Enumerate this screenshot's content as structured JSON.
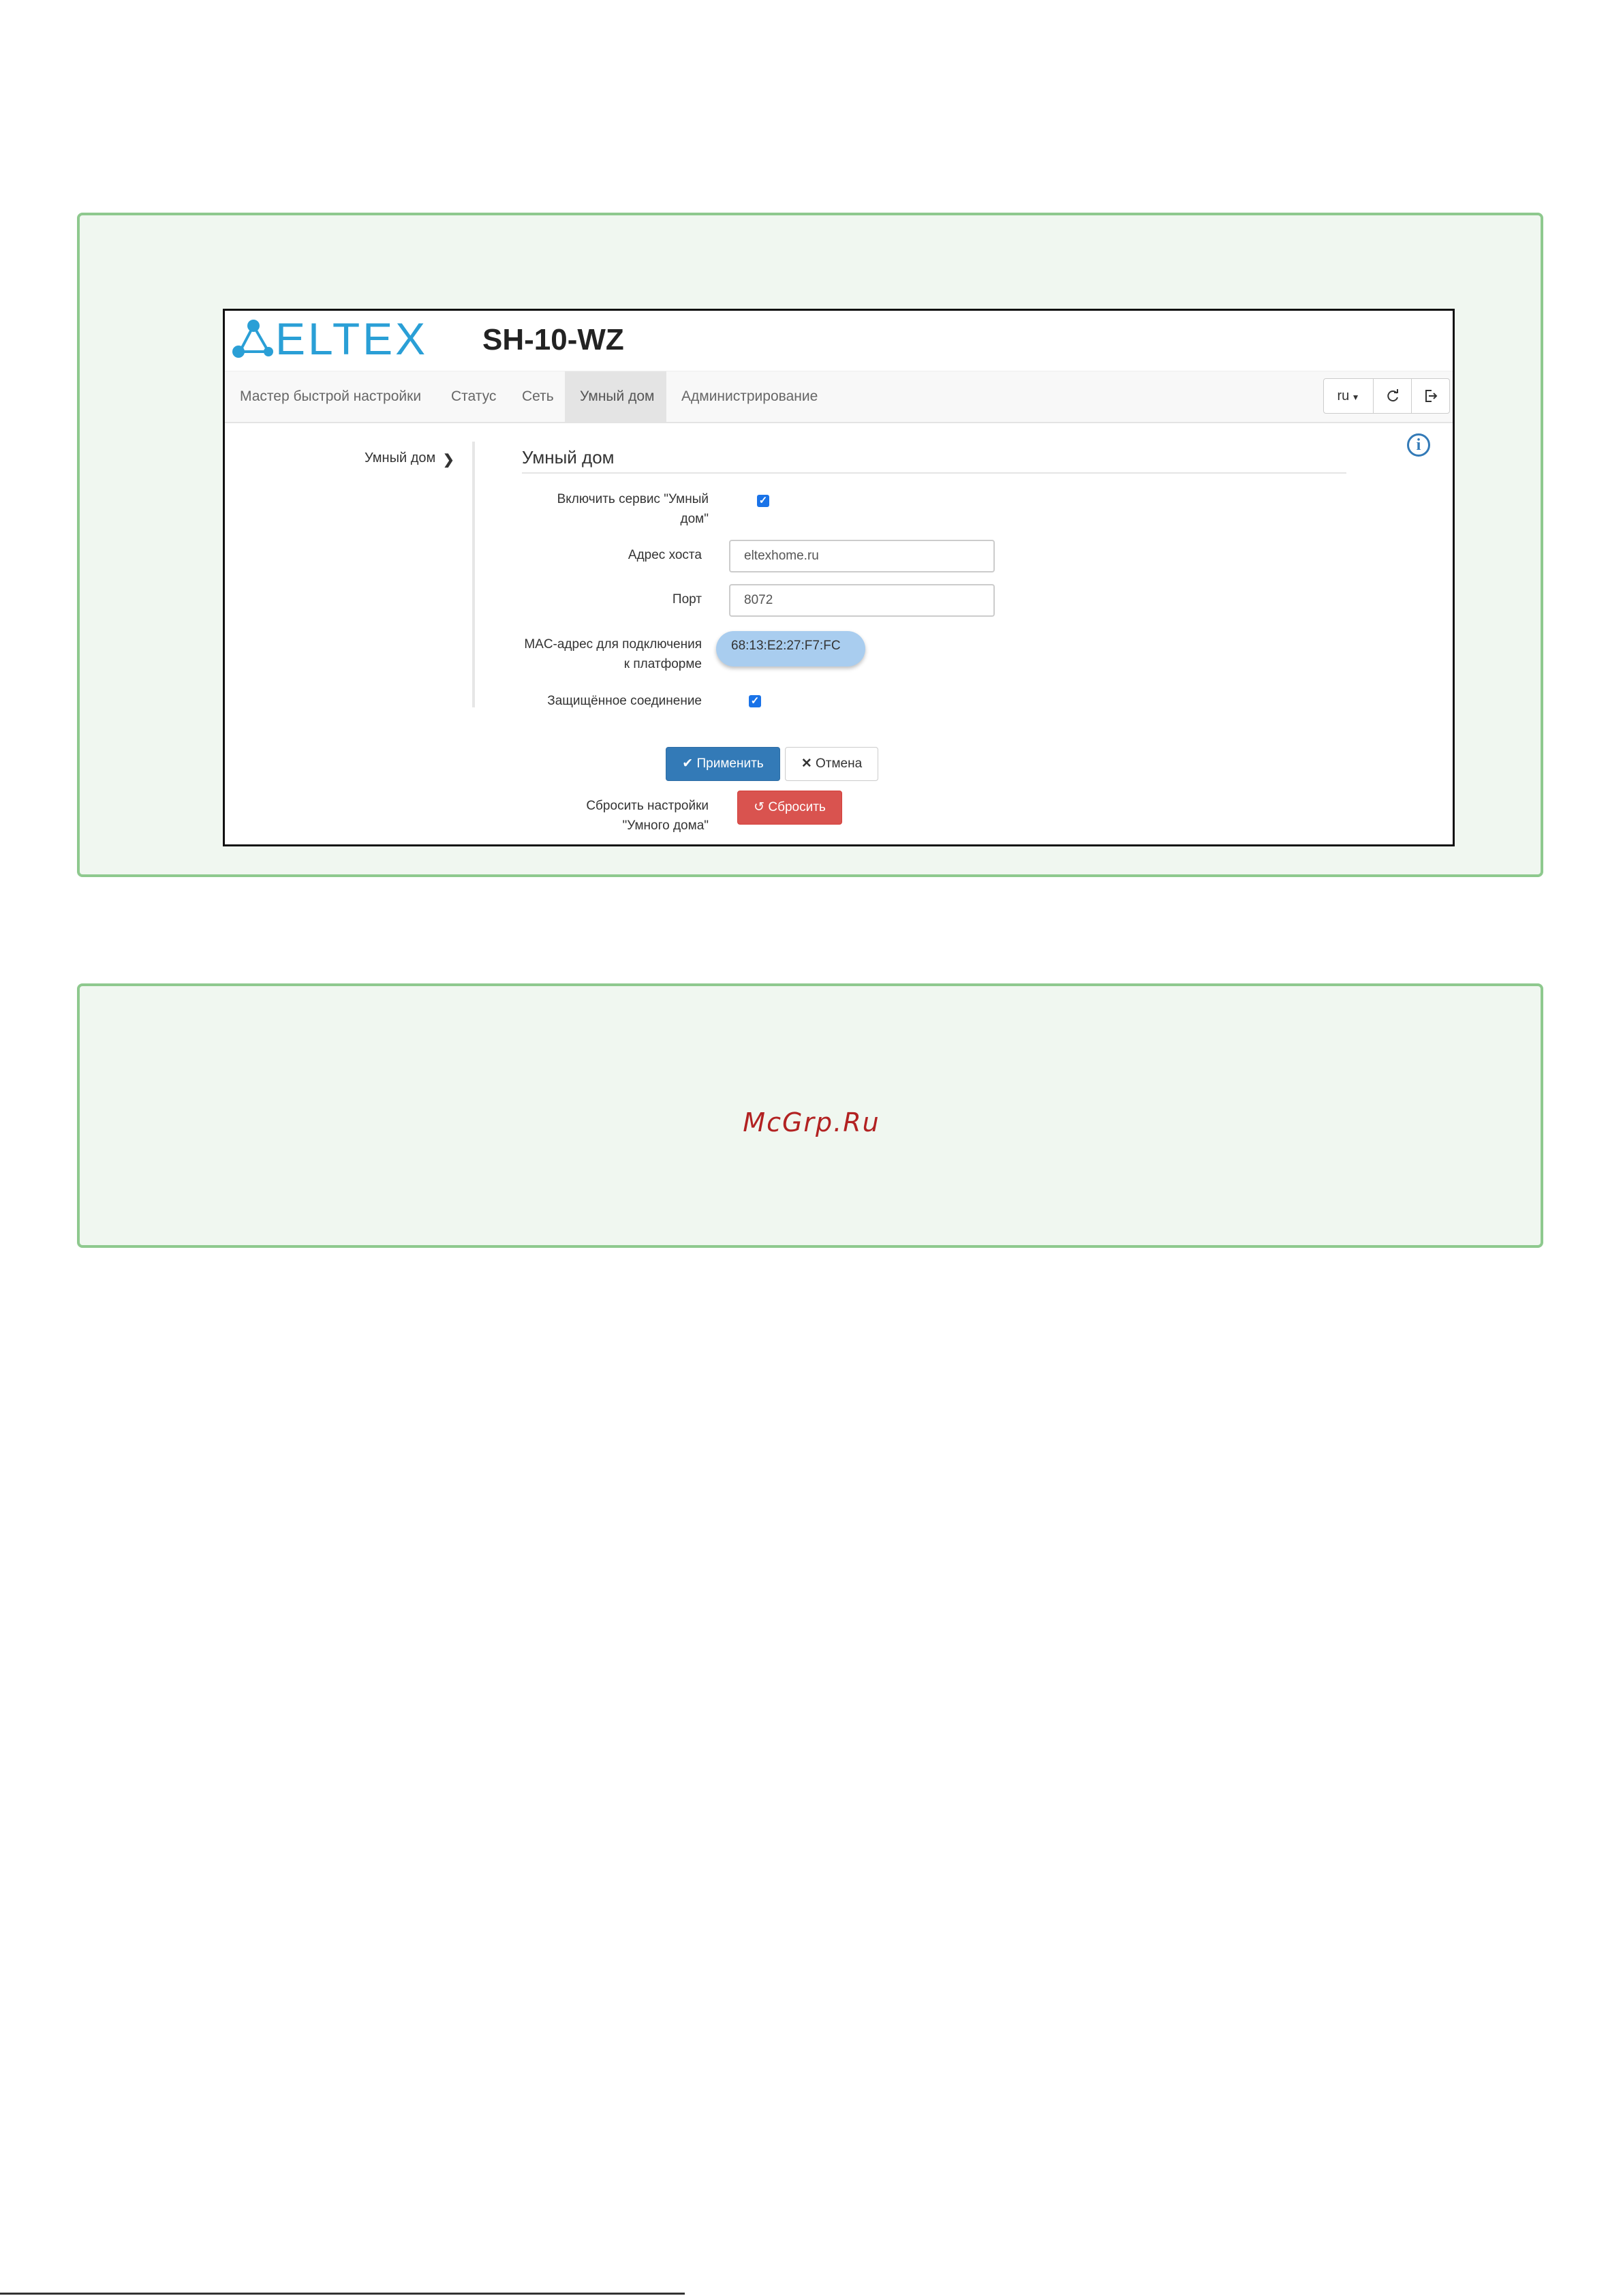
{
  "header": {
    "logo_text": "ELTEX",
    "model": "SH-10-WZ"
  },
  "nav": {
    "items": [
      {
        "label": "Мастер быстрой настройки"
      },
      {
        "label": "Статус"
      },
      {
        "label": "Сеть"
      },
      {
        "label": "Умный дом",
        "active": true
      },
      {
        "label": "Администрирование"
      }
    ],
    "language": "ru",
    "refresh_icon": "refresh-icon",
    "logout_icon": "logout-icon"
  },
  "sidebar": {
    "items": [
      {
        "label": "Умный дом"
      }
    ]
  },
  "form": {
    "legend": "Умный дом",
    "enable_label_line1": "Включить сервис \"Умный",
    "enable_label_line2": "дом\"",
    "enable_checked": true,
    "host_label": "Адрес хоста",
    "host_value": "eltexhome.ru",
    "port_label": "Порт",
    "port_value": "8072",
    "mac_label_line1": "MAC-адрес для подключения",
    "mac_label_line2": "к платформе",
    "mac_value": "68:13:E2:27:F7:FC",
    "secure_label": "Защищённое соединение",
    "secure_checked": true,
    "apply_label": "Применить",
    "cancel_label": "Отмена",
    "reset_label_line1": "Сбросить настройки",
    "reset_label_line2": "\"Умного дома\"",
    "reset_button": "Сбросить"
  },
  "watermark": "McGrp.Ru",
  "colors": {
    "accent": "#337ab7",
    "logo": "#2a9fd6",
    "danger": "#d9534f",
    "panel_border": "#8ec98e",
    "watermark": "#b22222"
  }
}
